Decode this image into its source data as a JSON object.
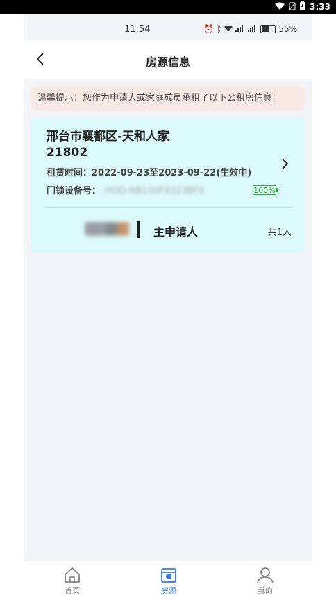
{
  "system_status": {
    "time": "3:33"
  },
  "inner_status": {
    "time": "11:54",
    "battery": "55%"
  },
  "header": {
    "title": "房源信息"
  },
  "notice": {
    "text": "温馨提示：您作为申请人或家庭成员承租了以下公租房信息!"
  },
  "property": {
    "name": "邢台市襄都区-天和人家",
    "unit": "21802",
    "lease_label": "租赁时间：",
    "lease_period": "2022-09-23至2023-09-22(生效中)",
    "device_label": "门锁设备号：",
    "device_id": "HOD-NB100F4323BF4",
    "lock_battery": "100%",
    "tenant_role": "主申请人",
    "tenant_count": "共1人"
  },
  "tabs": [
    {
      "label": "首页",
      "icon": "home-icon"
    },
    {
      "label": "房源",
      "icon": "house-icon",
      "active": true
    },
    {
      "label": "我的",
      "icon": "user-icon"
    }
  ],
  "colors": {
    "accent": "#2f79d8",
    "card_bg": "#dcfafc",
    "notice_bg": "#f8e9e4",
    "battery_green": "#2bb52b"
  }
}
